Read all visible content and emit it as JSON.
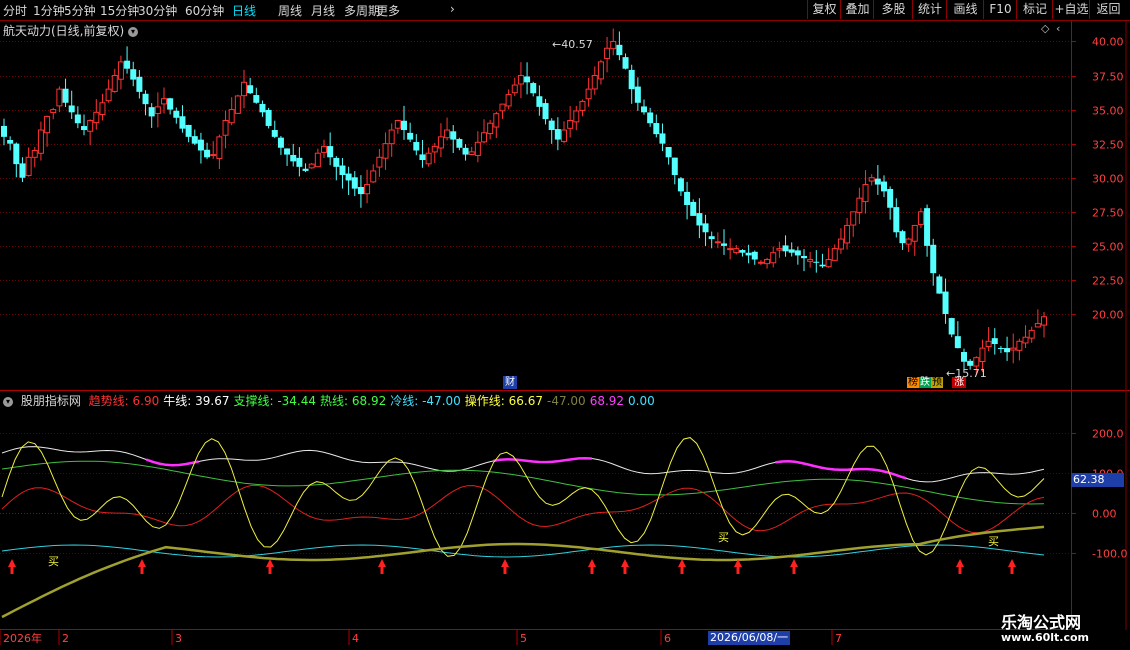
{
  "toolbar": {
    "timeframes": [
      "分时",
      "1分钟",
      "5分钟",
      "15分钟",
      "30分钟",
      "60分钟",
      "日线",
      "周线",
      "月线",
      "多周期",
      "更多"
    ],
    "active_timeframe": "日线",
    "right_buttons": [
      "复权",
      "叠加",
      "多股",
      "统计",
      "画线",
      "F10",
      "标记",
      "+自选",
      "返回"
    ]
  },
  "stock": {
    "title": "航天动力(日线,前复权)"
  },
  "price_axis": {
    "ticks": [
      "40.00",
      "37.50",
      "35.00",
      "32.50",
      "30.00",
      "27.50",
      "25.00",
      "22.50",
      "20.00"
    ]
  },
  "annotations": {
    "high": "40.57",
    "low": "15.71",
    "cai": "财",
    "tags": [
      "榜",
      "跌",
      "预",
      "涨"
    ]
  },
  "indicator": {
    "name": "股朋指标网",
    "items": [
      {
        "label": "趋势线:",
        "value": "6.90",
        "color": "#ff3030"
      },
      {
        "label": "牛线:",
        "value": "39.67",
        "color": "#ffffff"
      },
      {
        "label": "支撑线:",
        "value": "-34.44",
        "color": "#40ff40"
      },
      {
        "label": "热线:",
        "value": "68.92",
        "color": "#40ff40"
      },
      {
        "label": "冷线:",
        "value": "-47.00",
        "color": "#40e0ff"
      },
      {
        "label": "操作线:",
        "value": "66.67",
        "color": "#ffff40"
      }
    ],
    "extra_values": [
      "-47.00",
      "68.92",
      "0.00"
    ],
    "axis_ticks": [
      "200.0",
      "100.0",
      "0.00",
      "-100.0"
    ],
    "current_value": "62.38",
    "buy_label": "买"
  },
  "time_axis": {
    "labels": [
      "2026年",
      "2",
      "3",
      "4",
      "5",
      "6",
      "7"
    ],
    "cursor_date": "2026/06/08/一"
  },
  "watermark": {
    "line1": "乐淘公式网",
    "line2": "www.60lt.com"
  },
  "chart_data": {
    "type": "candlestick",
    "title": "航天动力(日线,前复权)",
    "y_ticks": [
      40.0,
      37.5,
      35.0,
      32.5,
      30.0,
      27.5,
      25.0,
      22.5,
      20.0
    ],
    "ylim": [
      14.5,
      41.5
    ],
    "max_price": 40.57,
    "min_price": 15.71,
    "closes": [
      33,
      32.5,
      31,
      30,
      31.5,
      32,
      33.5,
      34.5,
      35,
      36.5,
      35.5,
      34.8,
      34,
      33.5,
      34.2,
      34.8,
      35.5,
      36.5,
      37.5,
      38.5,
      38,
      37.2,
      36.3,
      35.4,
      34.5,
      35.2,
      35.8,
      35.0,
      34.4,
      33.6,
      33.0,
      32.5,
      32.0,
      31.5,
      31.7,
      33.0,
      34.2,
      35.0,
      36.0,
      37.0,
      36.2,
      35.5,
      34.8,
      33.8,
      33.0,
      32.2,
      31.7,
      31.2,
      30.8,
      30.5,
      31.0,
      31.8,
      32.3,
      31.5,
      30.8,
      30.2,
      29.8,
      29.2,
      28.8,
      29.5,
      30.5,
      31.5,
      32.5,
      33.5,
      34.2,
      33.5,
      32.8,
      32.0,
      31.3,
      31.8,
      32.3,
      33.0,
      33.5,
      32.8,
      32.2,
      31.7,
      31.9,
      32.6,
      33.3,
      34.0,
      34.7,
      35.4,
      36.1,
      36.8,
      37.5,
      37.0,
      36.2,
      35.2,
      34.3,
      33.5,
      32.8,
      33.5,
      34.2,
      34.9,
      35.6,
      36.5,
      37.5,
      38.5,
      39.5,
      40.0,
      39.0,
      38.0,
      36.5,
      35.5,
      34.8,
      34.0,
      33.2,
      32.5,
      31.5,
      30.2,
      29.0,
      28.0,
      27.2,
      26.5,
      26.0,
      25.5,
      25.3,
      25.0,
      24.8,
      24.8,
      24.5,
      24.3,
      24.0,
      23.8,
      24.0,
      24.5,
      24.8,
      24.6,
      24.5,
      24.3,
      24.1,
      24.0,
      23.8,
      23.5,
      24.0,
      24.8,
      25.5,
      26.5,
      27.5,
      28.5,
      29.5,
      30.0,
      29.5,
      29.0,
      27.8,
      26.0,
      25.2,
      25.5,
      26.5,
      27.5,
      25.0,
      23.0,
      21.5,
      20.0,
      18.5,
      17.5,
      16.5,
      16.2,
      16.8,
      17.5,
      18.0,
      17.8,
      17.5,
      17.2,
      17.5,
      18.0,
      18.3,
      18.8,
      19.3,
      19.8
    ]
  }
}
